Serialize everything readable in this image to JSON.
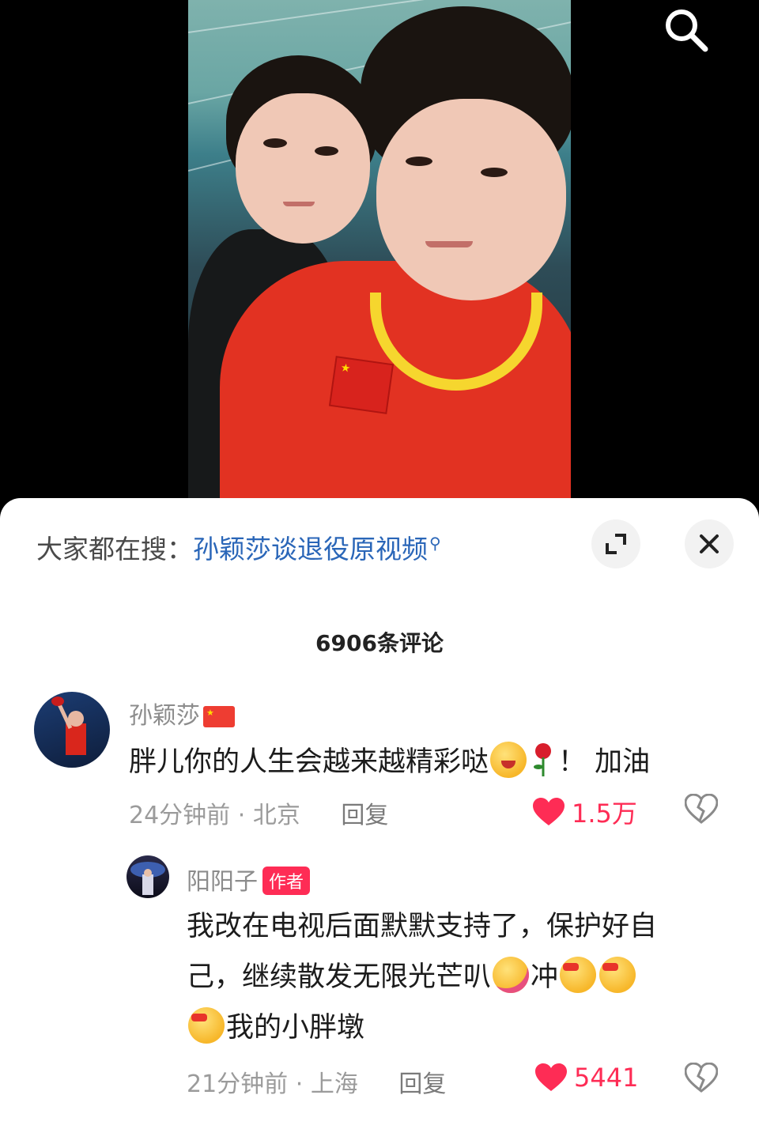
{
  "video": {
    "search_icon": "search-icon"
  },
  "sheet": {
    "hot_search_prefix": "大家都在搜：",
    "hot_search_term": "孙颖莎谈退役原视频",
    "hot_search_icon": "search-icon",
    "expand_icon": "expand-icon",
    "close_icon": "close-icon",
    "comment_count": "6906条评论"
  },
  "comments": [
    {
      "username": "孙颖莎",
      "flag_icon": "china-flag-icon",
      "text_before": "胖儿你的人生会越来越精彩哒",
      "emojis": [
        "wink-salute-emoji-icon",
        "rose-emoji-icon"
      ],
      "text_after": "！ 加油",
      "time": "24分钟前",
      "location": "北京",
      "separator": "·",
      "reply_label": "回复",
      "likes": "1.5万",
      "colors": {
        "like": "#fe2c55"
      }
    }
  ],
  "replies": [
    {
      "username": "阳阳子",
      "badge": "作者",
      "text_line1": "我改在电视后面默默支持了，保护好自",
      "text_line2a": "己，继续散发无限光芒叭",
      "text_line2b": "冲",
      "text_line3": "我的小胖墩",
      "time": "21分钟前",
      "location": "上海",
      "separator": "·",
      "reply_label": "回复",
      "likes": "5441",
      "colors": {
        "badge": "#fe2c55"
      }
    }
  ]
}
